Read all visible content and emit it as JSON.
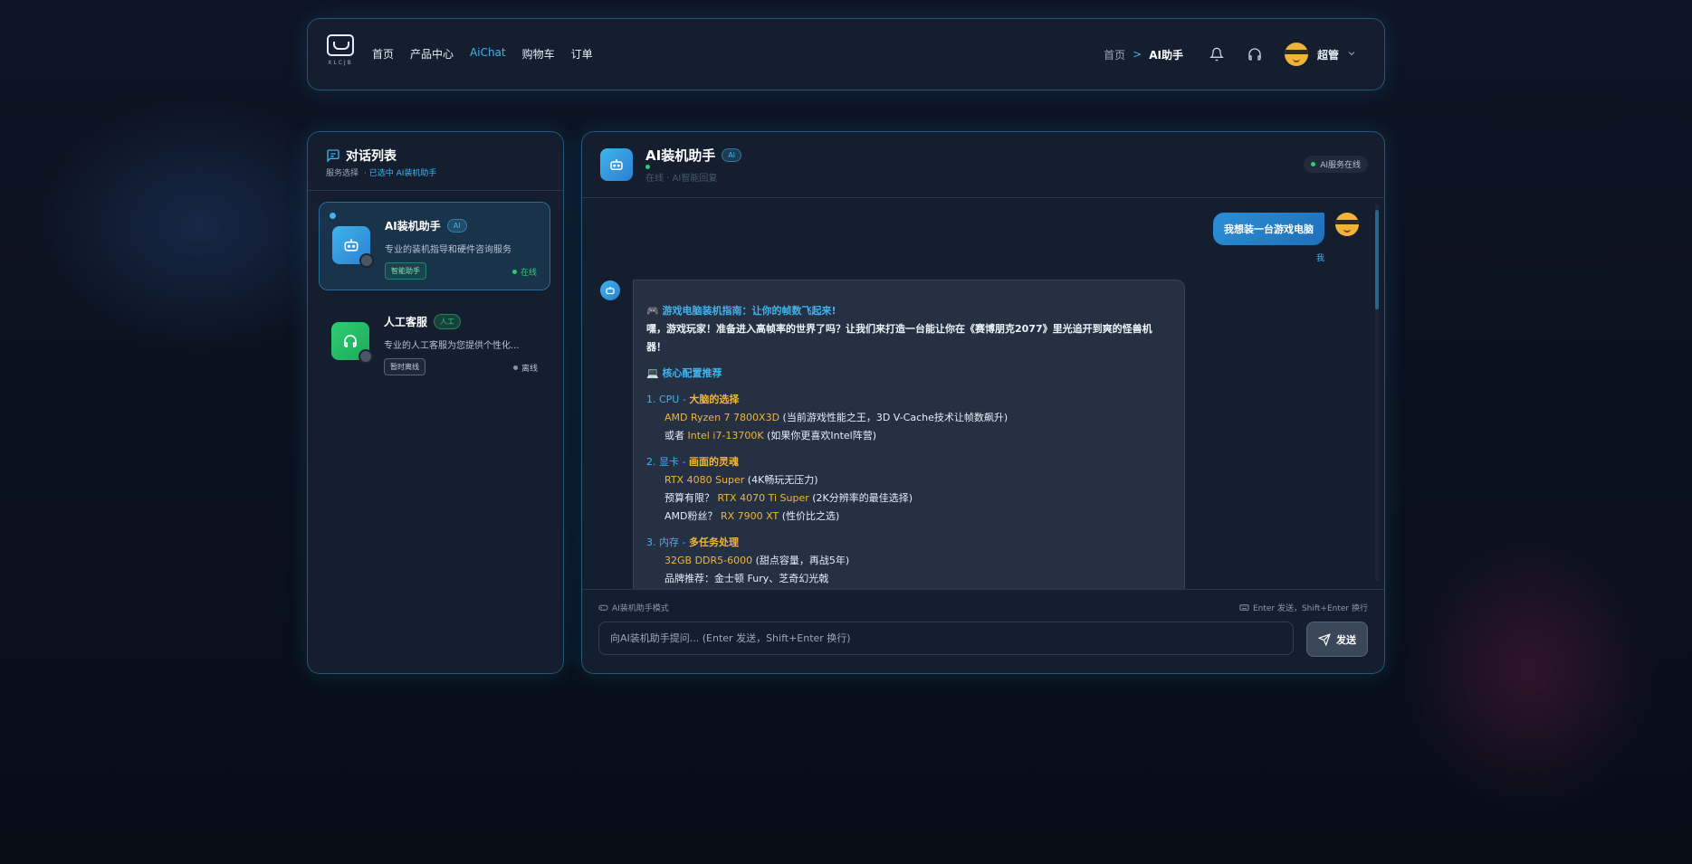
{
  "header": {
    "logo_text": "XLCJB",
    "nav": [
      {
        "label": "首页",
        "active": false
      },
      {
        "label": "产品中心",
        "active": false
      },
      {
        "label": "AiChat",
        "active": true
      },
      {
        "label": "购物车",
        "active": false
      },
      {
        "label": "订单",
        "active": false
      }
    ],
    "breadcrumb": {
      "home": "首页",
      "separator": ">",
      "current": "AI助手"
    },
    "icons": [
      "bell-icon",
      "headset-icon"
    ],
    "user": {
      "name": "超管"
    }
  },
  "sidebar": {
    "title": "对话列表",
    "subtitle": "服务选择",
    "selected_text": "· 已选中 AI装机助手",
    "conversations": [
      {
        "name": "AI装机助手",
        "badge": "AI",
        "desc": "专业的装机指导和硬件咨询服务",
        "tag": "智能助手",
        "status": "在线",
        "status_color": "#2ecc71"
      },
      {
        "name": "人工客服",
        "badge": "人工",
        "desc": "专业的人工客服为您提供个性化...",
        "tag": "暂时离线",
        "status": "离线",
        "status_color": "#8c96a3"
      }
    ]
  },
  "chat": {
    "title": "AI装机助手",
    "badge": "AI",
    "subtitle": "在线 · AI智能回复",
    "online_label": "AI服务在线",
    "user_message": "我想装一台游戏电脑",
    "user_label": "我",
    "bot": {
      "heading": "🎮 游戏电脑装机指南：让你的帧数飞起来!",
      "intro": "嘿，游戏玩家！准备进入高帧率的世界了吗？让我们来打造一台能让你在《赛博朋克2077》里光追开到爽的怪兽机器！",
      "section_heading": "💻 核心配置推荐",
      "sections": [
        {
          "num": "1. CPU - ",
          "title": "大脑的选择",
          "lines": [
            {
              "pre": "",
              "hl": "AMD Ryzen 7 7800X3D",
              "post": " (当前游戏性能之王，3D V-Cache技术让帧数飙升)"
            },
            {
              "pre": "或者 ",
              "hl": "Intel i7-13700K",
              "post": " (如果你更喜欢Intel阵营)"
            }
          ]
        },
        {
          "num": "2. 显卡 - ",
          "title": "画面的灵魂",
          "lines": [
            {
              "pre": "",
              "hl": "RTX 4080 Super",
              "post": " (4K畅玩无压力)"
            },
            {
              "pre": "预算有限？ ",
              "hl": "RTX 4070 Ti Super",
              "post": " (2K分辨率的最佳选择)"
            },
            {
              "pre": "AMD粉丝？ ",
              "hl": "RX 7900 XT",
              "post": " (性价比之选)"
            }
          ]
        },
        {
          "num": "3. 内存 - ",
          "title": "多任务处理",
          "lines": [
            {
              "pre": "",
              "hl": "32GB DDR5-6000",
              "post": " (甜点容量，再战5年)"
            },
            {
              "pre": "品牌推荐：金士顿 Fury、芝奇幻光戟",
              "hl": "",
              "post": ""
            }
          ]
        }
      ]
    },
    "input": {
      "mode_label": "AI装机助手模式",
      "hint": "Enter 发送，Shift+Enter 换行",
      "placeholder": "向AI装机助手提问... (Enter 发送，Shift+Enter 换行)",
      "value": "",
      "send_label": "发送"
    }
  },
  "colors": {
    "accent": "#3fb4ee",
    "highlight": "#f0b43a",
    "online": "#2ecc71",
    "human": "#2ecc71"
  }
}
